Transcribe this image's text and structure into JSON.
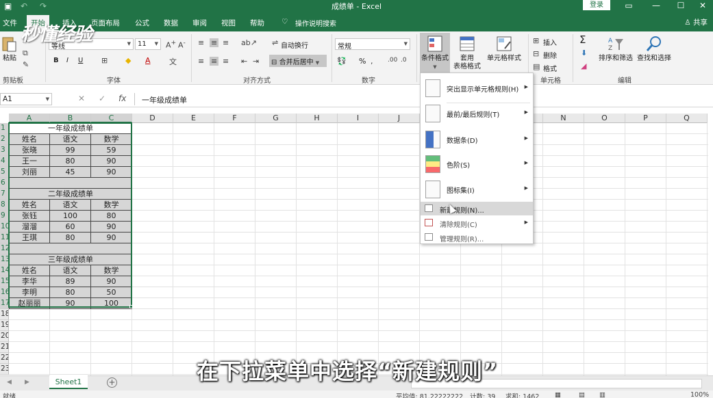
{
  "title_bar": {
    "title": "成绩单 - Excel",
    "login": "登录"
  },
  "menu": {
    "tabs": [
      "文件",
      "开始",
      "插入",
      "页面布局",
      "公式",
      "数据",
      "审阅",
      "视图",
      "帮助"
    ],
    "tell_me": "操作说明搜索",
    "share": "共享"
  },
  "ribbon": {
    "clipboard": {
      "paste": "粘贴",
      "label": "剪贴板"
    },
    "font": {
      "name": "等线",
      "size": "11",
      "bold": "B",
      "italic": "I",
      "underline": "U",
      "label": "字体"
    },
    "alignment": {
      "wrap": "自动换行",
      "merge": "合并后居中",
      "label": "对齐方式"
    },
    "number": {
      "format": "常规",
      "percent": "%",
      "label": "数字"
    },
    "styles": {
      "conditional": "条件格式",
      "table": "套用",
      "table2": "表格格式",
      "cell_styles": "单元格样式",
      "label": "样式"
    },
    "cells": {
      "insert": "插入",
      "delete": "删除",
      "format": "格式",
      "label": "单元格"
    },
    "editing": {
      "sum": "Σ",
      "sort_filter": "排序和筛选",
      "find_select": "查找和选择",
      "label": "编辑"
    }
  },
  "formula_bar": {
    "name_box": "A1",
    "fx": "fx",
    "content": "一年级成绩单"
  },
  "columns": [
    "A",
    "B",
    "C",
    "D",
    "E",
    "F",
    "G",
    "H",
    "I",
    "J",
    "K",
    "L",
    "M",
    "N",
    "O",
    "P",
    "Q"
  ],
  "rows": [
    "1",
    "2",
    "3",
    "4",
    "5",
    "6",
    "7",
    "8",
    "9",
    "10",
    "11",
    "12",
    "13",
    "14",
    "15",
    "16",
    "17",
    "18",
    "19",
    "20",
    "21",
    "22",
    "23"
  ],
  "tables": [
    {
      "title": "一年级成绩单",
      "headers": [
        "姓名",
        "语文",
        "数学"
      ],
      "rows": [
        [
          "张晓",
          "99",
          "59"
        ],
        [
          "王一",
          "80",
          "90"
        ],
        [
          "刘丽",
          "45",
          "90"
        ]
      ]
    },
    {
      "title": "二年级成绩单",
      "headers": [
        "姓名",
        "语文",
        "数学"
      ],
      "rows": [
        [
          "张钰",
          "100",
          "80"
        ],
        [
          "溜溜",
          "60",
          "90"
        ],
        [
          "王琪",
          "80",
          "90"
        ]
      ]
    },
    {
      "title": "三年级成绩单",
      "headers": [
        "姓名",
        "语文",
        "数学"
      ],
      "rows": [
        [
          "李华",
          "89",
          "90"
        ],
        [
          "李明",
          "80",
          "50"
        ],
        [
          "赵丽丽",
          "90",
          "100"
        ]
      ]
    }
  ],
  "conditional_menu": {
    "items": [
      {
        "label": "突出显示单元格规则(H)"
      },
      {
        "label": "最前/最后规则(T)"
      },
      {
        "label": "数据条(D)"
      },
      {
        "label": "色阶(S)"
      },
      {
        "label": "图标集(I)"
      }
    ],
    "small_items": [
      {
        "label": "新建规则(N)..."
      },
      {
        "label": "清除规则(C)"
      },
      {
        "label": "管理规则(R)..."
      }
    ]
  },
  "sheets": {
    "tab": "Sheet1",
    "add": "+"
  },
  "status": {
    "ready": "就绪",
    "average": "平均值: 81.22222222",
    "count": "计数: 39",
    "sum": "求和: 1462",
    "zoom": "100%"
  },
  "overlay": {
    "subtitle": "在下拉菜单中选择“新建规则”",
    "watermark": "秒懂经验"
  },
  "colors": {
    "accent": "#217346",
    "selected_header": "#d3d3d3",
    "table_fill": "#d6d6d6"
  }
}
